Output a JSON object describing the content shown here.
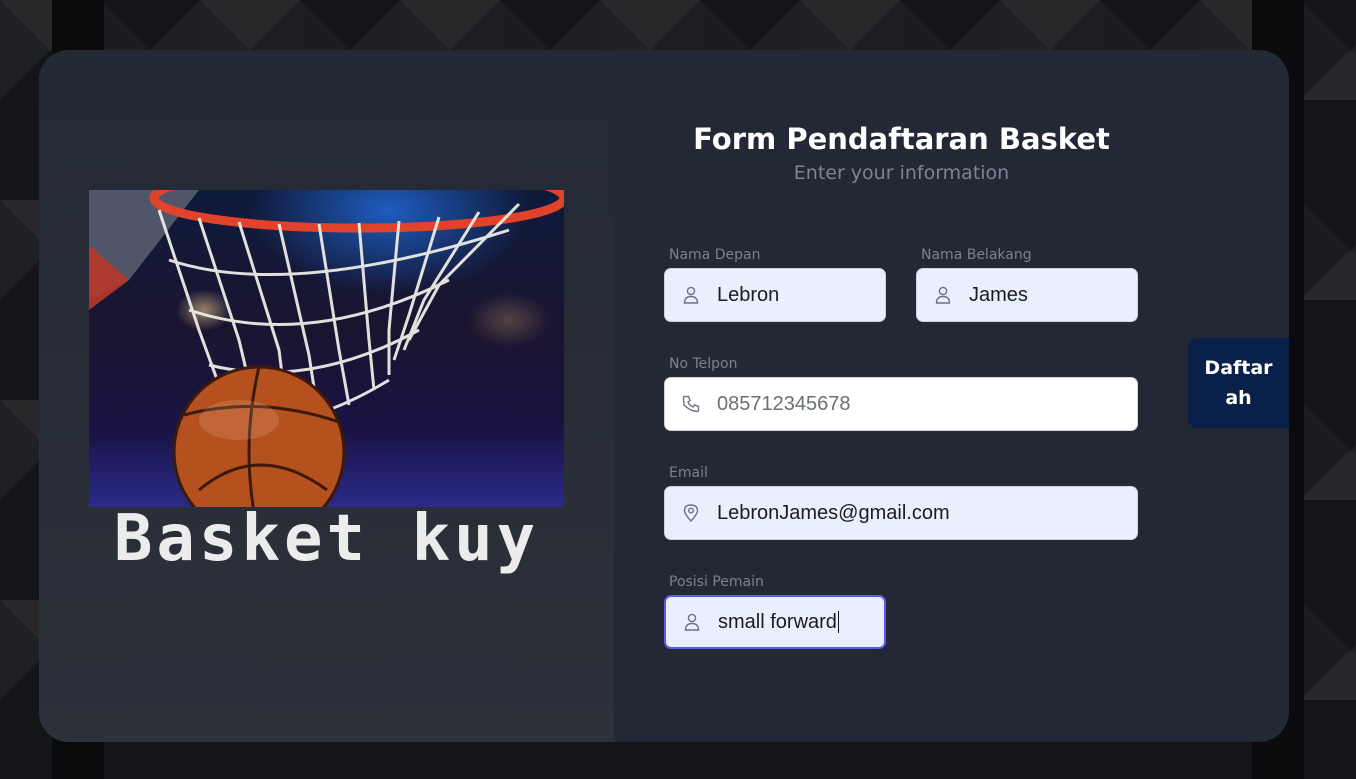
{
  "brand": {
    "logo_text": "Basket kuy"
  },
  "form": {
    "title": "Form Pendaftaran Basket",
    "subtitle": "Enter your information",
    "fields": {
      "first_name": {
        "label": "Nama Depan",
        "value": "Lebron",
        "icon": "user-icon"
      },
      "last_name": {
        "label": "Nama Belakang",
        "value": "James",
        "icon": "user-icon"
      },
      "phone": {
        "label": "No Telpon",
        "value": "085712345678",
        "icon": "phone-icon"
      },
      "email": {
        "label": "Email",
        "value": "LebronJames@gmail.com",
        "icon": "location-pin-icon"
      },
      "position": {
        "label": "Posisi Pemain",
        "value": "small forward",
        "icon": "user-icon"
      }
    },
    "submit_label": "Daftar ah"
  },
  "colors": {
    "card": "#222834",
    "submit": "#09204a",
    "input_fill": "#e8f0fe",
    "focus_border": "#5b5ce6"
  }
}
